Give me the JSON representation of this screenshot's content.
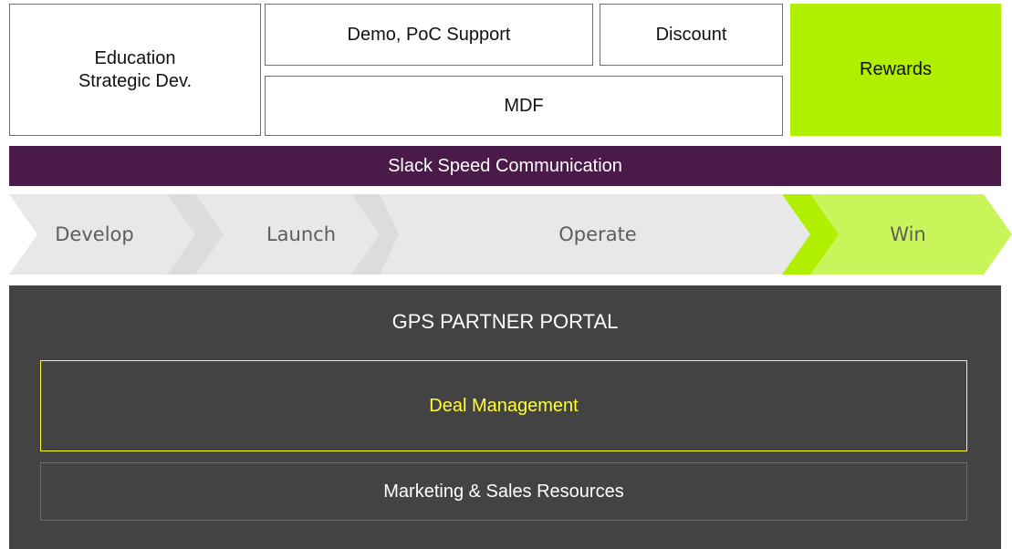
{
  "top": {
    "education": "Education\nStrategic Dev.",
    "demo": "Demo, PoC Support",
    "discount": "Discount",
    "mdf": "MDF",
    "rewards": "Rewards"
  },
  "banner": {
    "label": "Slack Speed Communication"
  },
  "stages": [
    "Develop",
    "Launch",
    "Operate",
    "Win"
  ],
  "portal": {
    "title": "GPS PARTNER PORTAL",
    "deal": "Deal Management",
    "marketing": "Marketing & Sales Resources"
  },
  "colors": {
    "accent_green": "#b0ef00",
    "win_green": "#c8f55a",
    "banner_purple": "#4a1a48",
    "portal_bg": "#434343",
    "highlight_yellow": "#ffff2e",
    "chevron_gray": "#e8e8e8"
  }
}
